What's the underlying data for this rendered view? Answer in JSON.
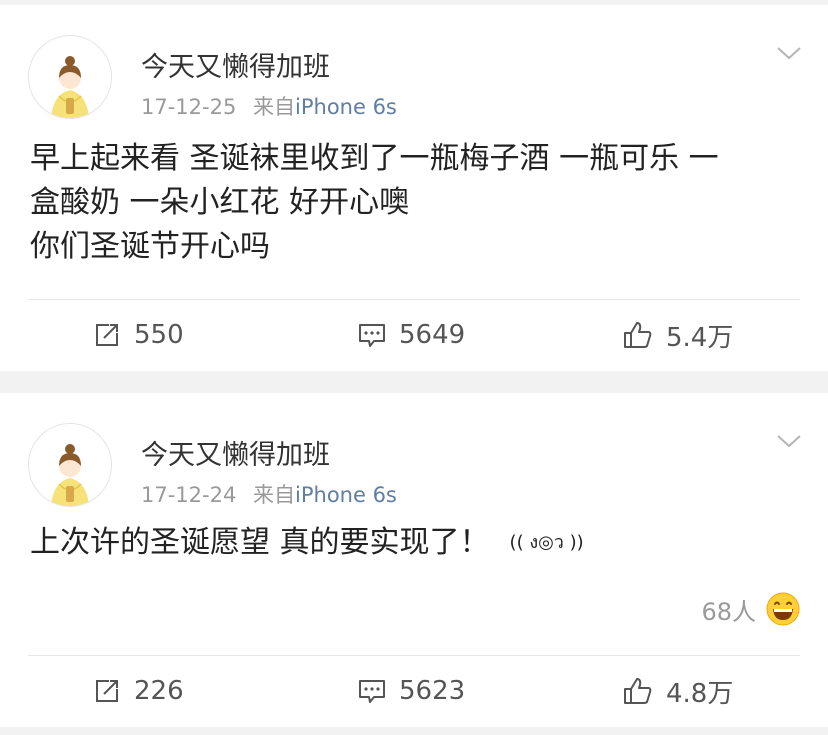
{
  "posts": [
    {
      "author": "今天又懒得加班",
      "date": "17-12-25",
      "source_prefix": "来自",
      "source": "iPhone 6s",
      "text": "早上起来看 圣诞袜里收到了一瓶梅子酒 一瓶可乐 一\n盒酸奶 一朵小红花 好开心噢\n你们圣诞节开心吗",
      "reposts": "550",
      "comments": "5649",
      "likes": "5.4万"
    },
    {
      "author": "今天又懒得加班",
      "date": "17-12-24",
      "source_prefix": "来自",
      "source": "iPhone 6s",
      "text": "上次许的圣诞愿望 真的要实现了！",
      "kaomoji": "(( ง◎ว ))",
      "reaction_count": "68人",
      "reposts": "226",
      "comments": "5623",
      "likes": "4.8万"
    }
  ],
  "colors": {
    "source_link": "#5f7ea1",
    "meta_gray": "#9a9a9a",
    "separator": "#f2f2f2"
  },
  "icons": [
    "chevron-down-icon",
    "repost-icon",
    "comment-icon",
    "thumbs-up-icon",
    "grinning-emoji-icon"
  ]
}
